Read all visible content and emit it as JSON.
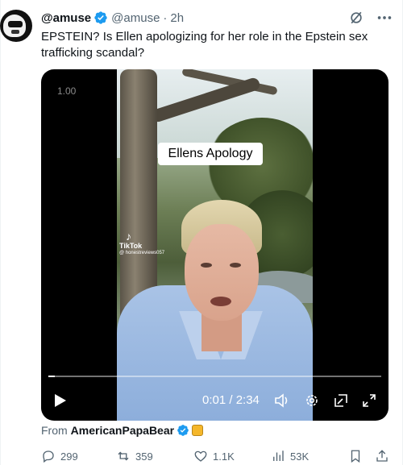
{
  "tweet": {
    "display_name": "@amuse",
    "handle": "@amuse",
    "separator": "·",
    "timestamp": "2h",
    "text": "EPSTEIN? Is Ellen apologizing for her role in the Epstein sex trafficking scandal?",
    "more_icon": "more-horizontal-icon",
    "grok_icon": "grok-icon"
  },
  "video": {
    "playback_rate": "1.00",
    "caption": "Ellens Apology",
    "watermark": {
      "brand": "TikTok",
      "user": "@ honestreviews057"
    },
    "timecode": "0:01 / 2:34",
    "progress": 0.006
  },
  "source": {
    "prefix": "From",
    "account": "AmericanPapaBear"
  },
  "actions": {
    "replies": "299",
    "reposts": "359",
    "likes": "1.1K",
    "views": "53K"
  },
  "colors": {
    "verified_blue": "#1d9bf0",
    "text_primary": "#0f1419",
    "text_secondary": "#536471"
  }
}
